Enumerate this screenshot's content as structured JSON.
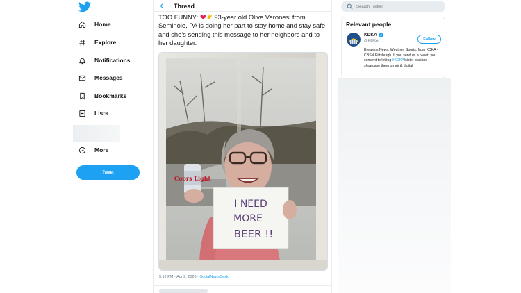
{
  "nav": {
    "items": [
      {
        "label": "Home",
        "icon": "home-icon"
      },
      {
        "label": "Explore",
        "icon": "hashtag-icon"
      },
      {
        "label": "Notifications",
        "icon": "bell-icon"
      },
      {
        "label": "Messages",
        "icon": "envelope-icon"
      },
      {
        "label": "Bookmarks",
        "icon": "bookmark-icon"
      },
      {
        "label": "Lists",
        "icon": "list-icon"
      },
      {
        "label": "More",
        "icon": "more-circle-icon"
      }
    ],
    "tweet_button": "Tweet"
  },
  "thread": {
    "title": "Thread",
    "text_prefix": "TOO FUNNY: ",
    "text_body": " 93-year old Olive Veronesi from Seminole, PA is doing her part to stay home and stay safe, and she's sending this message to her neighbors and to her daughter.",
    "sign_text_1": "I NEED",
    "sign_text_2": "MORE",
    "sign_text_3": "BEER !!",
    "can_label": "Coors Light",
    "meta_time": "5:12 PM · Apr 9, 2020 · ",
    "meta_source": "SocialNewsDesk"
  },
  "search": {
    "placeholder": "Search Twitter"
  },
  "relevant_people": {
    "title": "Relevant people",
    "name": "KDKA",
    "handle": "@KDKA",
    "follow_label": "Follow",
    "bio_1": "Breaking News, Weather, Sports, from KDKA - CBSN Pittsburgh. If you send us a tweet, you consent to letting ",
    "bio_hashtag": "#KDKA",
    "bio_2": "/sister stations showcase them on air & digital"
  },
  "colors": {
    "accent": "#1da1f2",
    "text": "#14171a",
    "muted": "#657786"
  }
}
